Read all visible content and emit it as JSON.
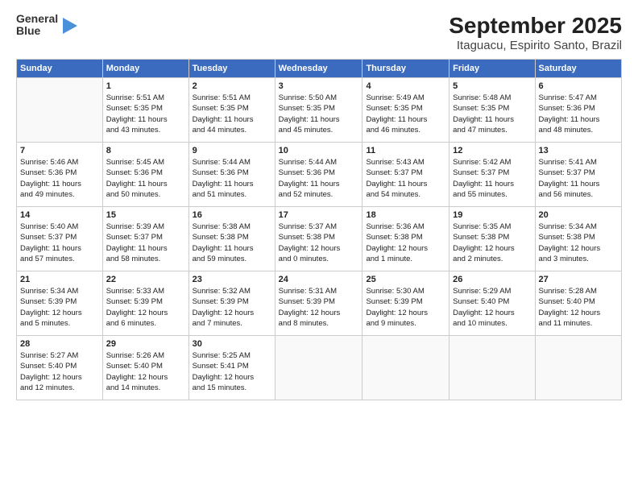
{
  "header": {
    "logo_line1": "General",
    "logo_line2": "Blue",
    "title": "September 2025",
    "subtitle": "Itaguacu, Espirito Santo, Brazil"
  },
  "weekdays": [
    "Sunday",
    "Monday",
    "Tuesday",
    "Wednesday",
    "Thursday",
    "Friday",
    "Saturday"
  ],
  "weeks": [
    [
      {
        "day": "",
        "detail": ""
      },
      {
        "day": "1",
        "detail": "Sunrise: 5:51 AM\nSunset: 5:35 PM\nDaylight: 11 hours\nand 43 minutes."
      },
      {
        "day": "2",
        "detail": "Sunrise: 5:51 AM\nSunset: 5:35 PM\nDaylight: 11 hours\nand 44 minutes."
      },
      {
        "day": "3",
        "detail": "Sunrise: 5:50 AM\nSunset: 5:35 PM\nDaylight: 11 hours\nand 45 minutes."
      },
      {
        "day": "4",
        "detail": "Sunrise: 5:49 AM\nSunset: 5:35 PM\nDaylight: 11 hours\nand 46 minutes."
      },
      {
        "day": "5",
        "detail": "Sunrise: 5:48 AM\nSunset: 5:35 PM\nDaylight: 11 hours\nand 47 minutes."
      },
      {
        "day": "6",
        "detail": "Sunrise: 5:47 AM\nSunset: 5:36 PM\nDaylight: 11 hours\nand 48 minutes."
      }
    ],
    [
      {
        "day": "7",
        "detail": "Sunrise: 5:46 AM\nSunset: 5:36 PM\nDaylight: 11 hours\nand 49 minutes."
      },
      {
        "day": "8",
        "detail": "Sunrise: 5:45 AM\nSunset: 5:36 PM\nDaylight: 11 hours\nand 50 minutes."
      },
      {
        "day": "9",
        "detail": "Sunrise: 5:44 AM\nSunset: 5:36 PM\nDaylight: 11 hours\nand 51 minutes."
      },
      {
        "day": "10",
        "detail": "Sunrise: 5:44 AM\nSunset: 5:36 PM\nDaylight: 11 hours\nand 52 minutes."
      },
      {
        "day": "11",
        "detail": "Sunrise: 5:43 AM\nSunset: 5:37 PM\nDaylight: 11 hours\nand 54 minutes."
      },
      {
        "day": "12",
        "detail": "Sunrise: 5:42 AM\nSunset: 5:37 PM\nDaylight: 11 hours\nand 55 minutes."
      },
      {
        "day": "13",
        "detail": "Sunrise: 5:41 AM\nSunset: 5:37 PM\nDaylight: 11 hours\nand 56 minutes."
      }
    ],
    [
      {
        "day": "14",
        "detail": "Sunrise: 5:40 AM\nSunset: 5:37 PM\nDaylight: 11 hours\nand 57 minutes."
      },
      {
        "day": "15",
        "detail": "Sunrise: 5:39 AM\nSunset: 5:37 PM\nDaylight: 11 hours\nand 58 minutes."
      },
      {
        "day": "16",
        "detail": "Sunrise: 5:38 AM\nSunset: 5:38 PM\nDaylight: 11 hours\nand 59 minutes."
      },
      {
        "day": "17",
        "detail": "Sunrise: 5:37 AM\nSunset: 5:38 PM\nDaylight: 12 hours\nand 0 minutes."
      },
      {
        "day": "18",
        "detail": "Sunrise: 5:36 AM\nSunset: 5:38 PM\nDaylight: 12 hours\nand 1 minute."
      },
      {
        "day": "19",
        "detail": "Sunrise: 5:35 AM\nSunset: 5:38 PM\nDaylight: 12 hours\nand 2 minutes."
      },
      {
        "day": "20",
        "detail": "Sunrise: 5:34 AM\nSunset: 5:38 PM\nDaylight: 12 hours\nand 3 minutes."
      }
    ],
    [
      {
        "day": "21",
        "detail": "Sunrise: 5:34 AM\nSunset: 5:39 PM\nDaylight: 12 hours\nand 5 minutes."
      },
      {
        "day": "22",
        "detail": "Sunrise: 5:33 AM\nSunset: 5:39 PM\nDaylight: 12 hours\nand 6 minutes."
      },
      {
        "day": "23",
        "detail": "Sunrise: 5:32 AM\nSunset: 5:39 PM\nDaylight: 12 hours\nand 7 minutes."
      },
      {
        "day": "24",
        "detail": "Sunrise: 5:31 AM\nSunset: 5:39 PM\nDaylight: 12 hours\nand 8 minutes."
      },
      {
        "day": "25",
        "detail": "Sunrise: 5:30 AM\nSunset: 5:39 PM\nDaylight: 12 hours\nand 9 minutes."
      },
      {
        "day": "26",
        "detail": "Sunrise: 5:29 AM\nSunset: 5:40 PM\nDaylight: 12 hours\nand 10 minutes."
      },
      {
        "day": "27",
        "detail": "Sunrise: 5:28 AM\nSunset: 5:40 PM\nDaylight: 12 hours\nand 11 minutes."
      }
    ],
    [
      {
        "day": "28",
        "detail": "Sunrise: 5:27 AM\nSunset: 5:40 PM\nDaylight: 12 hours\nand 12 minutes."
      },
      {
        "day": "29",
        "detail": "Sunrise: 5:26 AM\nSunset: 5:40 PM\nDaylight: 12 hours\nand 14 minutes."
      },
      {
        "day": "30",
        "detail": "Sunrise: 5:25 AM\nSunset: 5:41 PM\nDaylight: 12 hours\nand 15 minutes."
      },
      {
        "day": "",
        "detail": ""
      },
      {
        "day": "",
        "detail": ""
      },
      {
        "day": "",
        "detail": ""
      },
      {
        "day": "",
        "detail": ""
      }
    ]
  ]
}
